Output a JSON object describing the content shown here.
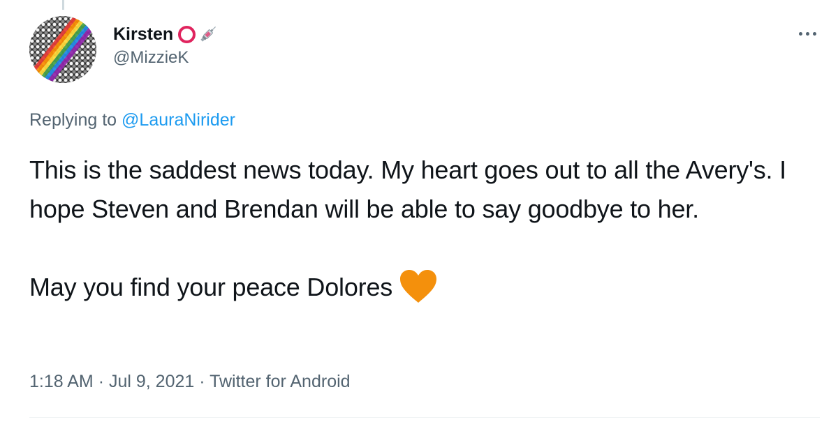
{
  "tweet": {
    "author": {
      "display_name": "Kirsten",
      "handle": "@MizzieK",
      "badge_icons": [
        "red-circle-icon",
        "syringe-icon"
      ]
    },
    "replying_prefix": "Replying to",
    "replying_to": "@LauraNirider",
    "text_paragraph_1": "This is the saddest news today. My heart goes out to all the Avery's. I hope Steven and Brendan will be able to say goodbye to her.",
    "text_paragraph_2": "May you find your peace Dolores",
    "emoji": "orange-heart-icon",
    "meta": {
      "time": "1:18 AM",
      "separator": "·",
      "date": "Jul 9, 2021",
      "source": "Twitter for Android"
    }
  },
  "colors": {
    "text_primary": "#0f1419",
    "text_secondary": "#536471",
    "link": "#1d9bf0",
    "red_circle": "#e0245e",
    "orange_heart": "#f4900c"
  }
}
